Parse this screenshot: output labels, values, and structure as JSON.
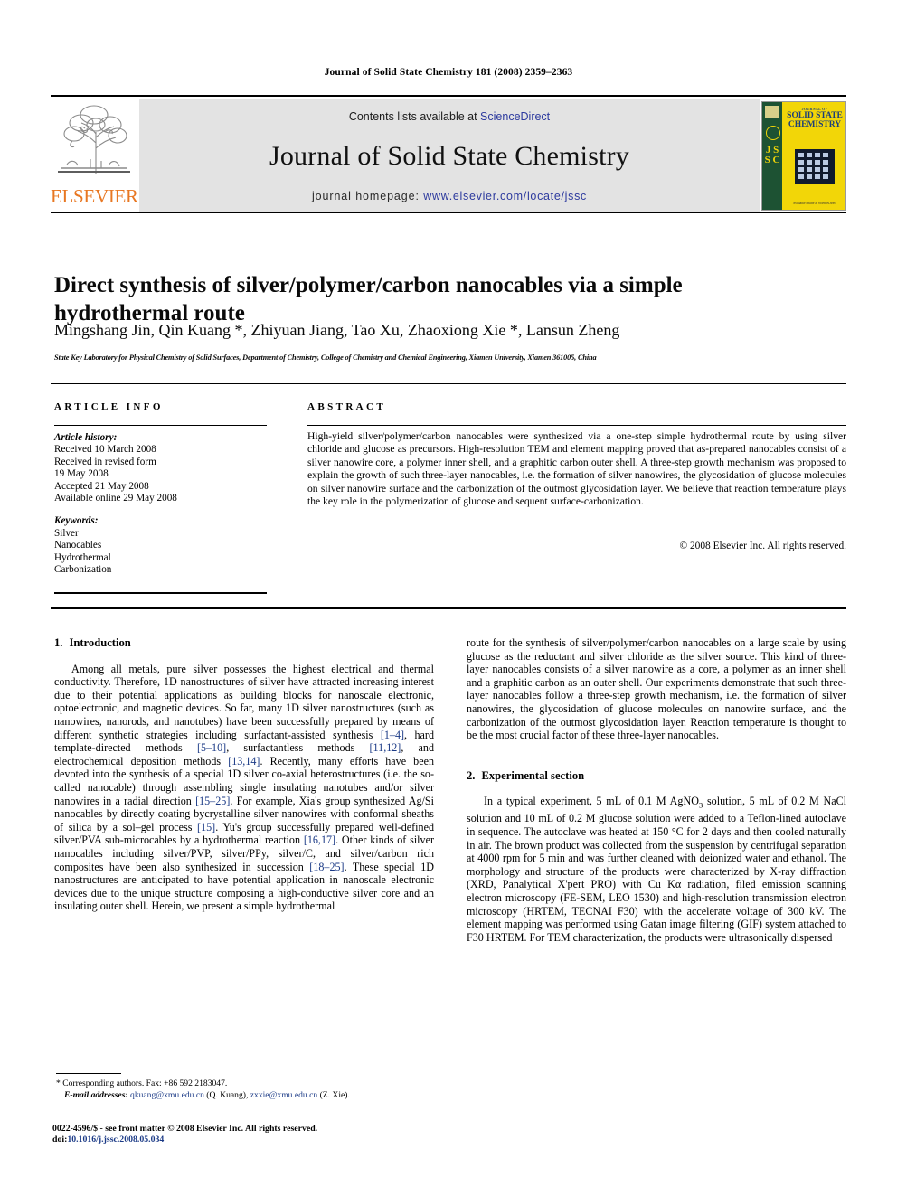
{
  "running_head": "Journal of Solid State Chemistry 181 (2008) 2359–2363",
  "masthead": {
    "contents_prefix": "Contents lists available at ",
    "sciencedirect_link": "ScienceDirect",
    "journal_title": "Journal of Solid State Chemistry",
    "homepage_prefix": "journal homepage: ",
    "homepage_link": "www.elsevier.com/locate/jssc",
    "publisher_wordmark": "ELSEVIER",
    "publisher_color": "#e87722",
    "link_color": "#2d3a9e",
    "band_color": "#e3e3e3",
    "cover": {
      "kicker": "JOURNAL OF",
      "line1": "SOLID STATE",
      "line2": "CHEMISTRY",
      "spine_letters": "J S S C",
      "footer_note": "Available online at\nScienceDirect",
      "background_color": "#f2d608",
      "spine_color": "#1d5233",
      "title_color": "#1d3f7a"
    }
  },
  "article": {
    "title": "Direct synthesis of silver/polymer/carbon nanocables via a simple hydrothermal route",
    "authors": "Mingshang Jin, Qin Kuang *, Zhiyuan Jiang, Tao Xu, Zhaoxiong Xie *, Lansun Zheng",
    "affiliation": "State Key Laboratory for Physical Chemistry of Solid Surfaces, Department of Chemistry, College of Chemistry and Chemical Engineering, Xiamen University, Xiamen 361005, China"
  },
  "info": {
    "heading": "ARTICLE INFO",
    "history_label": "Article history:",
    "history_lines": [
      "Received 10 March 2008",
      "Received in revised form",
      "19 May 2008",
      "Accepted 21 May 2008",
      "Available online 29 May 2008"
    ],
    "keywords_label": "Keywords:",
    "keywords": [
      "Silver",
      "Nanocables",
      "Hydrothermal",
      "Carbonization"
    ]
  },
  "abstract": {
    "heading": "ABSTRACT",
    "text": "High-yield silver/polymer/carbon nanocables were synthesized via a one-step simple hydrothermal route by using silver chloride and glucose as precursors. High-resolution TEM and element mapping proved that as-prepared nanocables consist of a silver nanowire core, a polymer inner shell, and a graphitic carbon outer shell. A three-step growth mechanism was proposed to explain the growth of such three-layer nanocables, i.e. the formation of silver nanowires, the glycosidation of glucose molecules on silver nanowire surface and the carbonization of the outmost glycosidation layer. We believe that reaction temperature plays the key role in the polymerization of glucose and sequent surface-carbonization.",
    "copyright": "© 2008 Elsevier Inc. All rights reserved."
  },
  "body": {
    "section1": {
      "number": "1.",
      "title": "Introduction",
      "paragraph_left_part1": "Among all metals, pure silver possesses the highest electrical and thermal conductivity. Therefore, 1D nanostructures of silver have attracted increasing interest due to their potential applications as building blocks for nanoscale electronic, optoelectronic, and magnetic devices. So far, many 1D silver nanostructures (such as nanowires, nanorods, and nanotubes) have been successfully prepared by means of different synthetic strategies including surfactant-assisted synthesis [1–4], hard template-directed methods [5–10], surfactantless methods [11,12], and electrochemical deposition methods [13,14]. Recently, many efforts have been devoted into the synthesis of a special 1D silver co-axial heterostructures (i.e. the so-called nanocable) through assembling single insulating nanotubes and/or silver nanowires in a radial direction [15–25]. For example, Xia's group synthesized Ag/Si nanocables by directly coating bycrystalline silver nanowires with conformal sheaths of silica by a sol–gel process [15]. Yu's group successfully prepared well-defined silver/PVA sub-microcables by a hydrothermal reaction [16,17]. Other kinds of silver nanocables including silver/PVP, silver/PPy, silver/C, and silver/carbon rich composites have been also synthesized in succession [18–25]. These special 1D nanostructures are anticipated to have potential application in nanoscale electronic devices due to the unique structure composing a high-conductive silver core and an insulating outer shell. Herein, we present a simple hydrothermal",
      "paragraph_right_part2": "route for the synthesis of silver/polymer/carbon nanocables on a large scale by using glucose as the reductant and silver chloride as the silver source. This kind of three-layer nanocables consists of a silver nanowire as a core, a polymer as an inner shell and a graphitic carbon as an outer shell. Our experiments demonstrate that such three-layer nanocables follow a three-step growth mechanism, i.e. the formation of silver nanowires, the glycosidation of glucose molecules on nanowire surface, and the carbonization of the outmost glycosidation layer. Reaction temperature is thought to be the most crucial factor of these three-layer nanocables."
    },
    "section2": {
      "number": "2.",
      "title": "Experimental section",
      "paragraph": "In a typical experiment, 5 mL of 0.1 M AgNO3 solution, 5 mL of 0.2 M NaCl solution and 10 mL of 0.2 M glucose solution were added to a Teflon-lined autoclave in sequence. The autoclave was heated at 150 °C for 2 days and then cooled naturally in air. The brown product was collected from the suspension by centrifugal separation at 4000 rpm for 5 min and was further cleaned with deionized water and ethanol. The morphology and structure of the products were characterized by X-ray diffraction (XRD, Panalytical X'pert PRO) with Cu Kα radiation, filed emission scanning electron microscopy (FE-SEM, LEO 1530) and high-resolution transmission electron microscopy (HRTEM, TECNAI F30) with the accelerate voltage of 300 kV. The element mapping was performed using Gatan image filtering (GIF) system attached to F30 HRTEM. For TEM characterization, the products were ultrasonically dispersed"
    }
  },
  "footnotes": {
    "corresponding": "* Corresponding authors. Fax: +86 592 2183047.",
    "email_label": "E-mail addresses:",
    "email_1": "qkuang@xmu.edu.cn",
    "email_1_owner": "(Q. Kuang),",
    "email_2": "zxxie@xmu.edu.cn",
    "email_2_owner": "(Z. Xie).",
    "imprint_line": "0022-4596/$ - see front matter © 2008 Elsevier Inc. All rights reserved.",
    "doi_label": "doi:",
    "doi_value": "10.1016/j.jssc.2008.05.034"
  }
}
